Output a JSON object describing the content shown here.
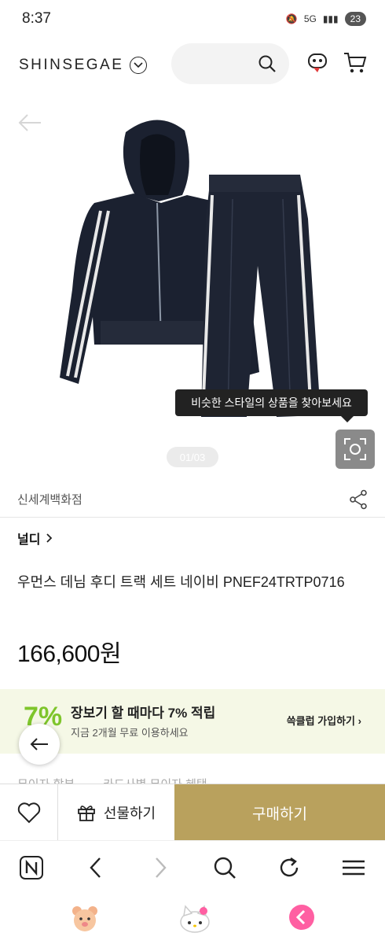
{
  "status": {
    "time": "8:37",
    "battery": "23",
    "network": "5G"
  },
  "header": {
    "brand": "SHINSEGAE"
  },
  "hero": {
    "tooltip": "비슷한 스타일의 상품을 찾아보세요",
    "pager": "01/03"
  },
  "product": {
    "store": "신세계백화점",
    "brand": "널디",
    "title": "우먼스 데님 후디 트랙 세트 네이비 PNEF24TRTP0716",
    "price": "166,600원"
  },
  "promo": {
    "badge": "7%",
    "title": "장보기 할 때마다 7% 적립",
    "subtitle": "지금 2개월 무료 이용하세요",
    "link": "쓱클럽 가입하기"
  },
  "tabs": [
    "무이자 할부",
    "카드사별 무이자 혜택"
  ],
  "buy_bar": {
    "gift_label": "선물하기",
    "buy_label": "구매하기"
  },
  "colors": {
    "buy": "#b9a15d",
    "promo_bg": "#f5f8e6",
    "promo_accent": "#7ec52b"
  }
}
